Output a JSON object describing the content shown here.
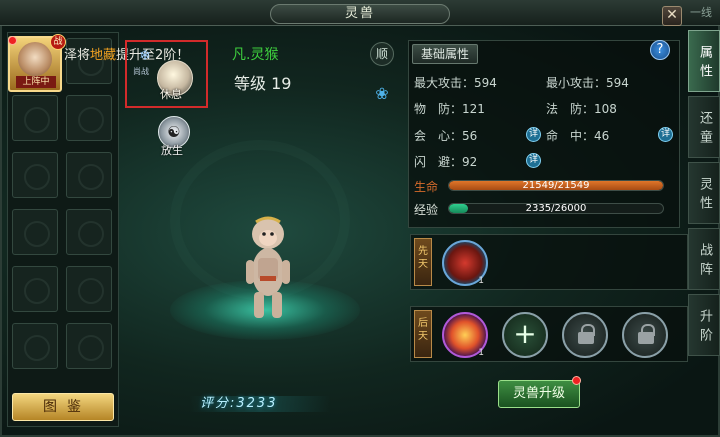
{
  "window": {
    "title": "灵兽",
    "close": "✕",
    "top_tab": "一线"
  },
  "slots": {
    "active_pet_tag": "上阵中",
    "battle_badge": "战",
    "gallery_button": "图鉴"
  },
  "marquee": {
    "prefix": "泽将",
    "highlight": "地藏",
    "suffix": "提升至2阶！"
  },
  "beast": {
    "name": "凡.灵猴",
    "level_label": "等级 19"
  },
  "actions": {
    "mode_label": "尚战",
    "rest": "休息",
    "release": "放生",
    "follow": "顺"
  },
  "score": "评分:3233",
  "info": {
    "tab": "基础属性",
    "help": "?",
    "max_attack": "最大攻击：594",
    "min_attack": "最小攻击：594",
    "phys_def": "物　防：121",
    "magic_def": "法　防：108",
    "crit": "会　心：56",
    "hit": "命　中：46",
    "dodge": "闪　避：92",
    "detail": "详",
    "hp_label": "生命",
    "hp_text": "21549/21549",
    "hp_fraction": 1.0,
    "xp_label": "经验",
    "xp_text": "2335/26000",
    "xp_fraction": 0.0898
  },
  "skills": {
    "innate_tag": "先天",
    "acquired_tag": "后天",
    "innate_count": "1",
    "acquired_count": "1",
    "add": "+",
    "more": "›"
  },
  "upgrade_button": "灵兽升级",
  "side_tabs": [
    "属性",
    "还童",
    "灵性",
    "战阵",
    "升阶"
  ],
  "colors": {
    "hp": "#e0762a",
    "xp": "#2fcf8f",
    "accent_gold": "#f3d279"
  }
}
